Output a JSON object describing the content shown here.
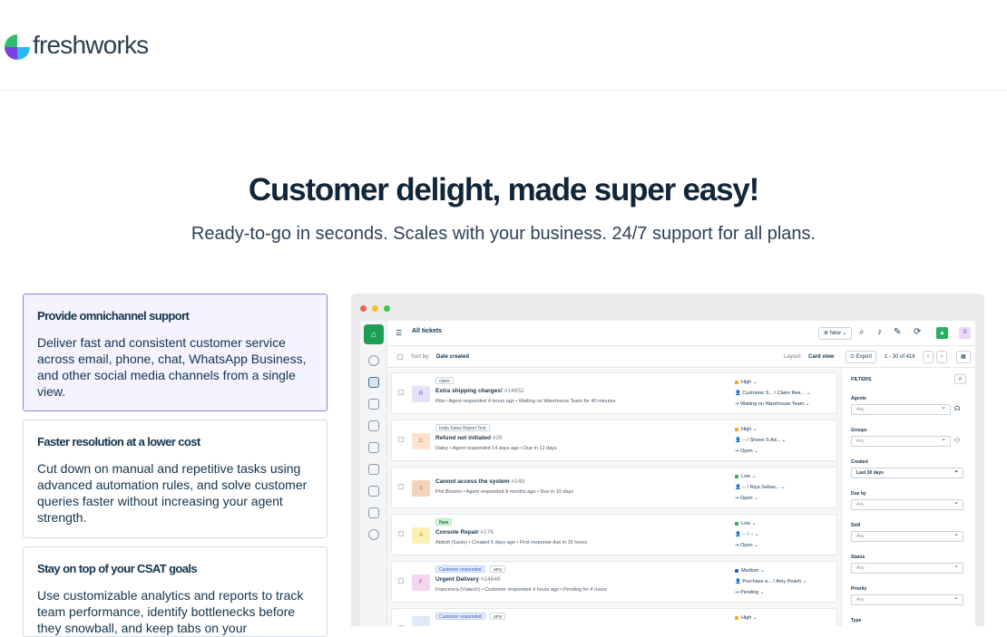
{
  "brand": {
    "name": "freshworks"
  },
  "hero": {
    "title": "Customer delight, made super easy!",
    "subtitle": "Ready-to-go in seconds. Scales with your business. 24/7 support for all plans."
  },
  "features": [
    {
      "title": "Provide omnichannel support",
      "body": "Deliver fast and consistent customer service across email, phone, chat, WhatsApp Business, and other social media channels from a single view.",
      "active": true
    },
    {
      "title": "Faster resolution at a lower cost",
      "body": "Cut down on manual and repetitive tasks using advanced automation rules, and solve customer queries faster without increasing your agent strength.",
      "active": false
    },
    {
      "title": "Stay on top of your CSAT goals",
      "body": "Use customizable analytics and reports to track team performance, identify bottlenecks before they snowball, and keep tabs on your",
      "active": false
    }
  ],
  "app": {
    "title": "All tickets",
    "new_label": "New",
    "sort_label": "Sort by:",
    "sort_value": "Date created",
    "layout_label": "Layout:",
    "layout_value": "Card view",
    "export_label": "Export",
    "pagination": "1 - 30 of 416",
    "tickets": [
      {
        "avatar": "R",
        "avatar_bg": "#e7e1f7",
        "avatar_fg": "#7b3fe4",
        "tag": "claire",
        "tag_type": "plain",
        "tag2": "",
        "subject": "Extra shipping charges!",
        "number": "#14652",
        "meta": "Rita • Agent responded 4 hours ago • Waiting on Warehouse Team for 40 minutes",
        "priority": "High",
        "priority_color": "#f5a623",
        "assignee": "Customer S... / Claire Ree...",
        "status": "Waiting on Warehouse Team"
      },
      {
        "avatar": "D",
        "avatar_bg": "#fde3cf",
        "avatar_fg": "#d9731a",
        "tag": "India Sales Report Test",
        "tag_type": "plain",
        "tag2": "",
        "subject": "Refund not initiated",
        "number": "#26",
        "meta": "Daley • Agent responded 14 days ago • Due in 12 days",
        "priority": "High",
        "priority_color": "#f5a623",
        "assignee": "-- / Sheen S Ad...",
        "status": "Open"
      },
      {
        "avatar": "PB",
        "avatar_bg": "#f2d3b9",
        "avatar_fg": "#7a4a2a",
        "tag": "",
        "tag_type": "plain",
        "tag2": "",
        "subject": "Cannot access the system",
        "number": "#149",
        "meta": "Phil Blooms • Agent responded 8 months ago • Due in 10 days",
        "priority": "Low",
        "priority_color": "#27ae60",
        "assignee": "-- / Riya Sebas...",
        "status": "Open"
      },
      {
        "avatar": "A",
        "avatar_bg": "#fbf0b4",
        "avatar_fg": "#a08400",
        "tag": "New",
        "tag_type": "new",
        "tag2": "",
        "subject": "Console Repair",
        "number": "#176",
        "meta": "Abbott (Sauls) • Created 5 days ago • First response due in 16 hours",
        "priority": "Low",
        "priority_color": "#27ae60",
        "assignee": "-- / --",
        "status": "Open"
      },
      {
        "avatar": "F",
        "avatar_bg": "#f6d5ef",
        "avatar_fg": "#b03a95",
        "tag": "Customer responded",
        "tag_type": "cr",
        "tag2": "amy",
        "subject": "Urgent Delivery",
        "number": "#14648",
        "meta": "Francesca (Viatech) • Customer responded 4 hours ago • Pending for 4 hours",
        "priority": "Medium",
        "priority_color": "#2c5cc5",
        "assignee": "Purchase a... / Amy Peach",
        "status": "Pending"
      },
      {
        "avatar": "",
        "avatar_bg": "#dfe8f5",
        "avatar_fg": "#2c5cc5",
        "tag": "Customer responded",
        "tag_type": "cr",
        "tag2": "amy",
        "subject": "",
        "number": "",
        "meta": "",
        "priority": "High",
        "priority_color": "#f5a623",
        "assignee": "",
        "status": ""
      }
    ],
    "filters": {
      "title": "FILTERS",
      "fields": [
        {
          "label": "Agents",
          "value": "Any",
          "set": false
        },
        {
          "label": "Groups",
          "value": "Any",
          "set": false
        },
        {
          "label": "Created",
          "value": "Last 30 days",
          "set": true
        },
        {
          "label": "Due by",
          "value": "Any",
          "set": false
        },
        {
          "label": "Skill",
          "value": "Any",
          "set": false
        },
        {
          "label": "Status",
          "value": "Any",
          "set": false
        },
        {
          "label": "Priority",
          "value": "Any",
          "set": false
        },
        {
          "label": "Type",
          "value": "",
          "set": false
        }
      ]
    }
  },
  "colors": {
    "accent": "#8d80f2",
    "active_bg": "#f4f3ff",
    "text": "#12344d"
  }
}
